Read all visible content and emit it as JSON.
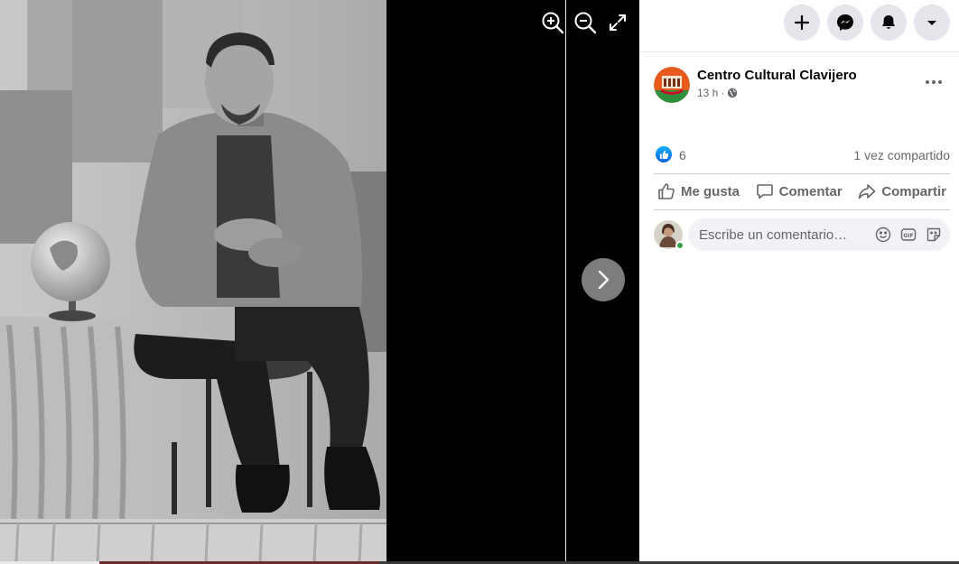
{
  "viewer": {
    "tools": [
      "zoom-in-icon",
      "zoom-out-icon",
      "fullscreen-icon"
    ],
    "next_icon": "chevron-right-icon"
  },
  "nav": {
    "buttons": [
      "plus-icon",
      "messenger-icon",
      "bell-icon",
      "caret-down-icon"
    ]
  },
  "post": {
    "page_name": "Centro Cultural Clavijero",
    "time": "13 h",
    "audience_icon": "globe-icon",
    "more_icon": "more-dots-icon",
    "reactions": {
      "like_count": "6",
      "shares": "1 vez compartido"
    },
    "actions": {
      "like": "Me gusta",
      "comment": "Comentar",
      "share": "Compartir"
    },
    "comment_box": {
      "placeholder": "Escribe un comentario…",
      "icons": [
        "emoji-icon",
        "gif-icon",
        "sticker-icon"
      ]
    }
  },
  "colors": {
    "accent": "#1877f2",
    "text_primary": "#050505",
    "text_secondary": "#65676b",
    "nav_button_bg": "#e4e6eb",
    "online": "#31a24c"
  }
}
